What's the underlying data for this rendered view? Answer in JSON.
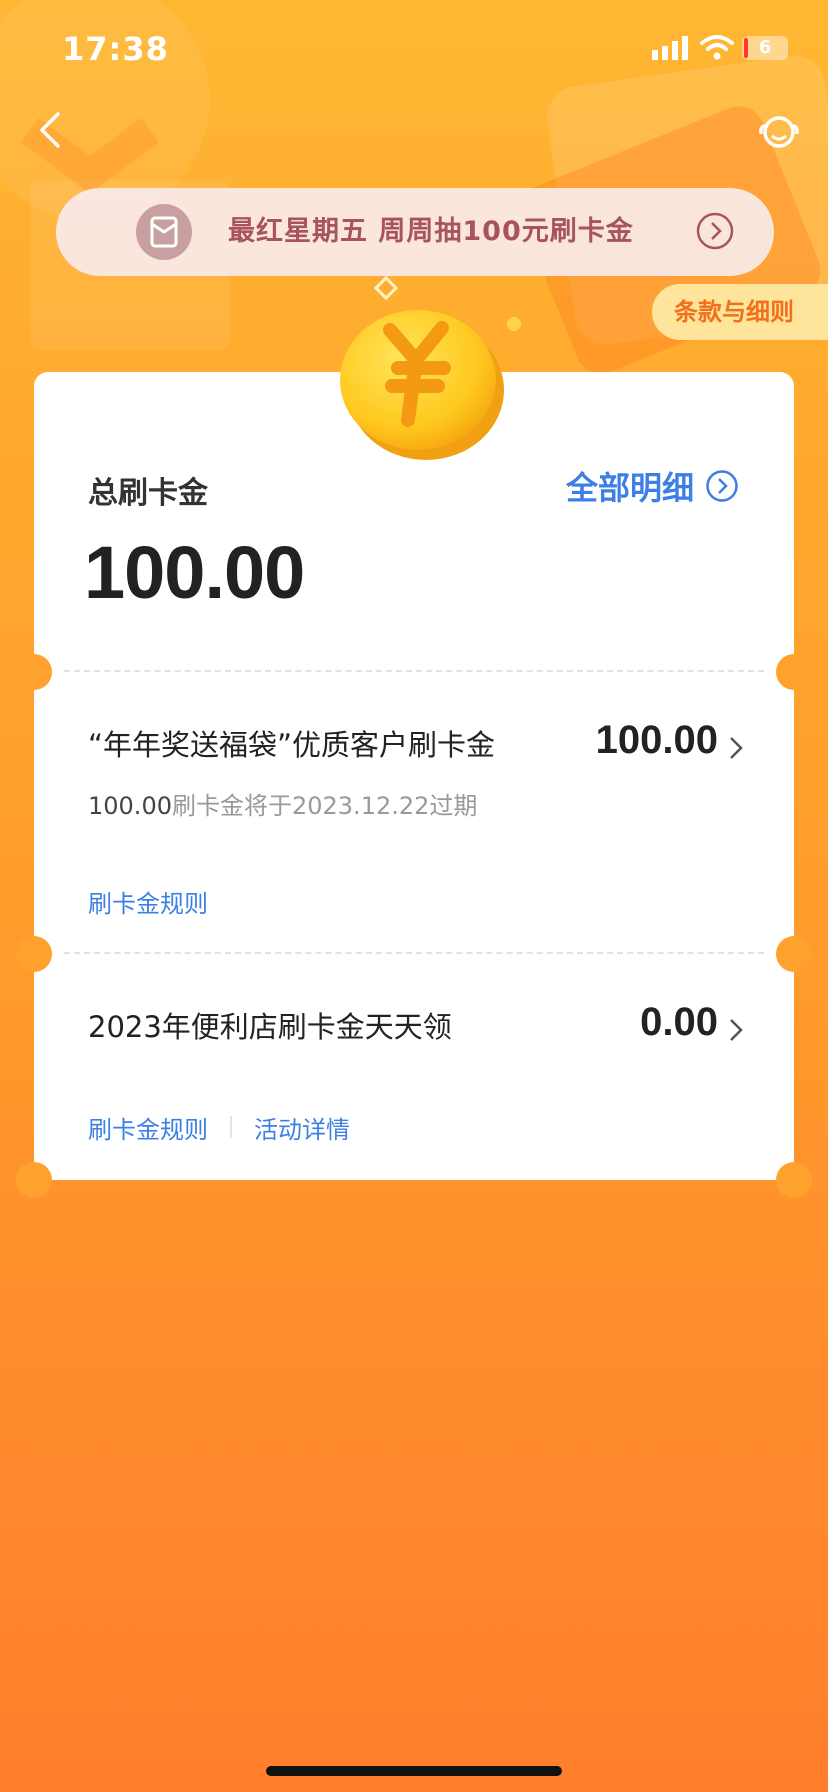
{
  "status_bar": {
    "time": "17:38",
    "battery": "6"
  },
  "banner": {
    "text": "最红星期五 周周抽100元刷卡金"
  },
  "terms_button": {
    "label": "条款与细则"
  },
  "summary": {
    "total_label": "总刷卡金",
    "total_value": "100.00",
    "all_details_label": "全部明细"
  },
  "items": [
    {
      "title": "“年年奖送福袋”优质客户刷卡金",
      "amount": "100.00",
      "expire_amount": "100.00",
      "expire_text": "刷卡金将于2023.12.22过期",
      "rules_link": "刷卡金规则"
    },
    {
      "title": "2023年便利店刷卡金天天领",
      "amount": "0.00",
      "rules_link": "刷卡金规则",
      "details_link": "活动详情"
    }
  ],
  "colors": {
    "accent_blue": "#3d7fe6",
    "background_orange": "#ff9a2c",
    "banner_text": "#a8545d",
    "terms_text": "#f2701c"
  },
  "icons": [
    "back-arrow-icon",
    "customer-service-icon",
    "red-packet-icon",
    "chevron-right-circle-icon",
    "coin-icon",
    "chevron-right-icon"
  ]
}
